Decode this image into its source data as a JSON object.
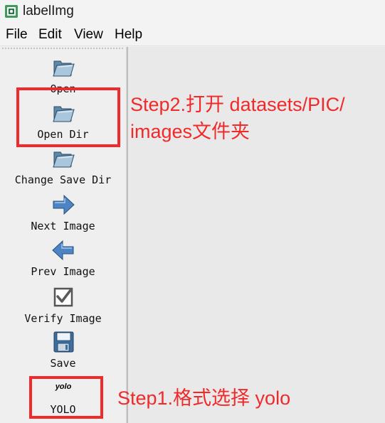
{
  "window": {
    "title": "labelImg",
    "app_icon": "labelimg-app-icon"
  },
  "menu": {
    "items": [
      {
        "label": "File"
      },
      {
        "label": "Edit"
      },
      {
        "label": "View"
      },
      {
        "label": "Help"
      }
    ]
  },
  "toolbar": {
    "open_label": "Open",
    "open_dir_label": "Open Dir",
    "change_save_dir_label": "Change Save Dir",
    "next_image_label": "Next Image",
    "prev_image_label": "Prev Image",
    "verify_image_label": "Verify Image",
    "save_label": "Save",
    "format_icon_text": "yolo",
    "format_label": "YOLO"
  },
  "annotations": {
    "step2_line1": "Step2.打开 datasets/PIC/",
    "step2_line2": "images文件夹",
    "step1": "Step1.格式选择 yolo",
    "color": "#f02a2a"
  }
}
